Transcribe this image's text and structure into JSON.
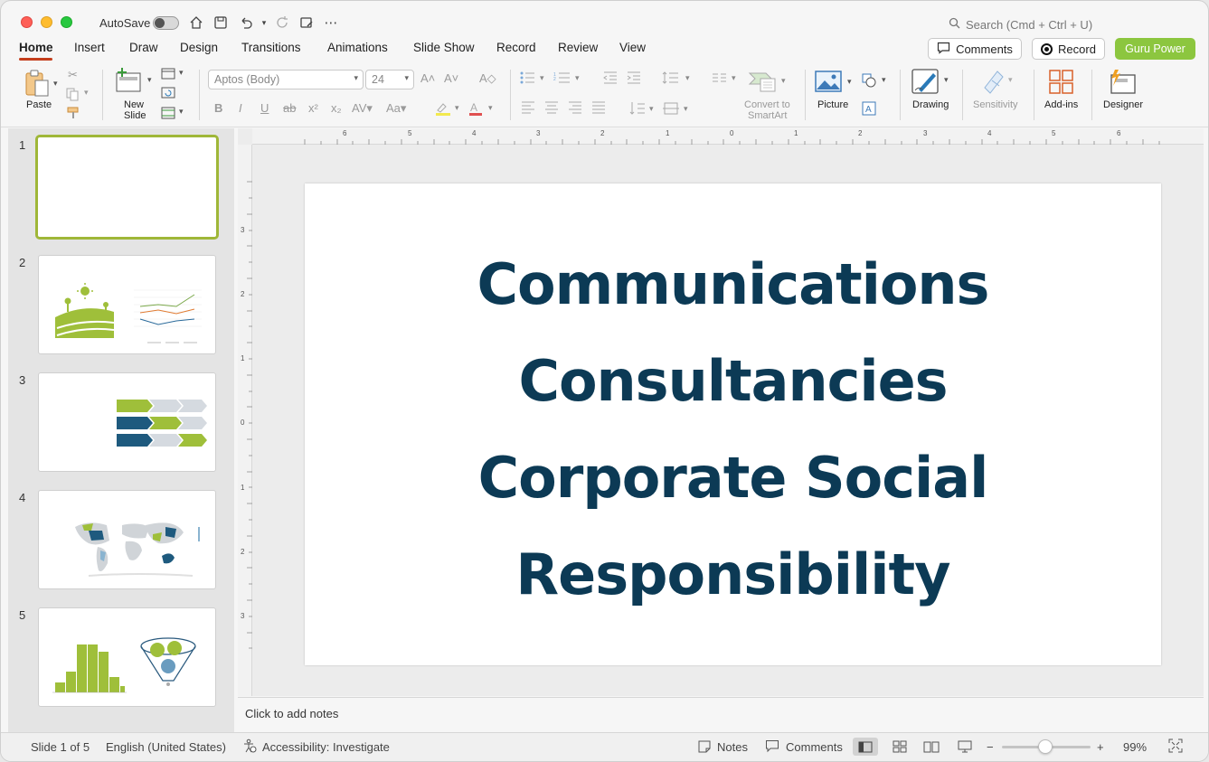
{
  "titlebar": {
    "autosave_label": "AutoSave",
    "search_placeholder": "Search (Cmd + Ctrl + U)"
  },
  "tabs": [
    {
      "label": "Home"
    },
    {
      "label": "Insert"
    },
    {
      "label": "Draw"
    },
    {
      "label": "Design"
    },
    {
      "label": "Transitions"
    },
    {
      "label": "Animations"
    },
    {
      "label": "Slide Show"
    },
    {
      "label": "Record"
    },
    {
      "label": "Review"
    },
    {
      "label": "View"
    }
  ],
  "header_buttons": {
    "comments": "Comments",
    "record": "Record",
    "guru": "Guru Power"
  },
  "ribbon": {
    "paste": "Paste",
    "new_slide_1": "New",
    "new_slide_2": "Slide",
    "font_name": "Aptos (Body)",
    "font_size": "24",
    "convert_1": "Convert to",
    "convert_2": "SmartArt",
    "picture": "Picture",
    "drawing": "Drawing",
    "sensitivity": "Sensitivity",
    "addins": "Add-ins",
    "designer": "Designer"
  },
  "thumbnails": [
    {
      "num": "1"
    },
    {
      "num": "2"
    },
    {
      "num": "3"
    },
    {
      "num": "4"
    },
    {
      "num": "5"
    }
  ],
  "slide": {
    "lines": [
      "Communications",
      "Consultancies",
      "Corporate Social",
      "Responsibility"
    ]
  },
  "notes_placeholder": "Click to add notes",
  "status": {
    "slide_info": "Slide 1 of 5",
    "language": "English (United States)",
    "accessibility": "Accessibility: Investigate",
    "notes": "Notes",
    "comments": "Comments",
    "zoom": "99%"
  },
  "ruler": {
    "h_labels": [
      "6",
      "5",
      "4",
      "3",
      "2",
      "1",
      "0",
      "1",
      "2",
      "3",
      "4",
      "5",
      "6"
    ],
    "v_labels": [
      "3",
      "2",
      "1",
      "0",
      "1",
      "2",
      "3"
    ]
  },
  "colors": {
    "accent_tab": "#c43e1c",
    "guru_button": "#8cc63f",
    "slide_text": "#0c3a55",
    "thumb_selected": "#9fb738"
  }
}
